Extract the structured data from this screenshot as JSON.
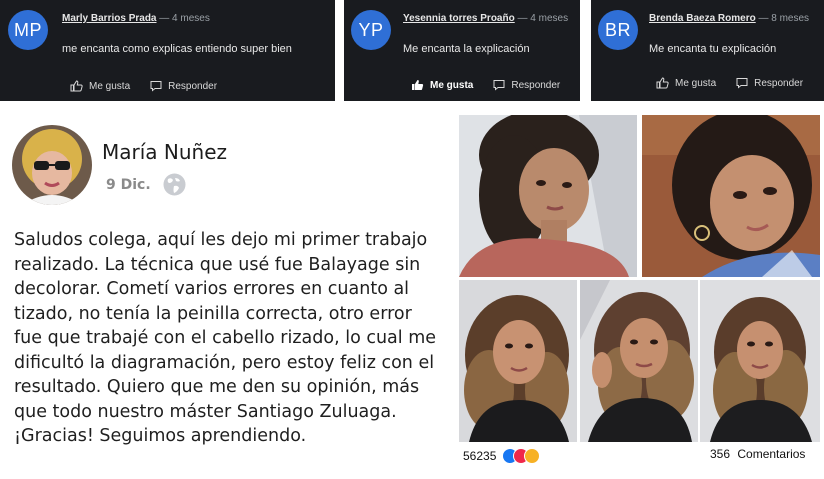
{
  "comments": [
    {
      "initials": "MP",
      "name": "Marly Barrios Prada",
      "time": "— 4 meses",
      "text": "me encanta como explicas entiendo super bien",
      "like": "Me gusta",
      "reply": "Responder",
      "liked": false
    },
    {
      "initials": "YP",
      "name": "Yesennia torres Proaño",
      "time": "— 4 meses",
      "text": "Me encanta la explicación",
      "like": "Me gusta",
      "reply": "Responder",
      "liked": true
    },
    {
      "initials": "BR",
      "name": "Brenda Baeza Romero",
      "time": "— 8 meses",
      "text": "Me encanta tu explicación",
      "like": "Me gusta",
      "reply": "Responder",
      "liked": false
    }
  ],
  "post": {
    "author": "María Nuñez",
    "date": "9 Dic.",
    "text": "Saludos colega, aquí les dejo mi primer trabajo realizado. La técnica que usé fue Balayage sin decolorar. Cometí varios errores en cuanto al tizado, no tenía la peinilla correcta, otro error fue que trabajé con el cabello rizado, lo cual me dificultó la diagramación, pero estoy feliz con el resultado. Quiero que me den su opinión, más que todo nuestro máster Santiago Zuluaga. ¡Gracias! Seguimos aprendiendo.",
    "reactions_count": "56235",
    "comments_count": "356",
    "comments_label": "Comentarios"
  },
  "colors": {
    "avatar": "#2f6fd6",
    "card_bg": "#191b1f",
    "like": "#1877f2",
    "love": "#f0284a",
    "wow": "#f7b125"
  }
}
